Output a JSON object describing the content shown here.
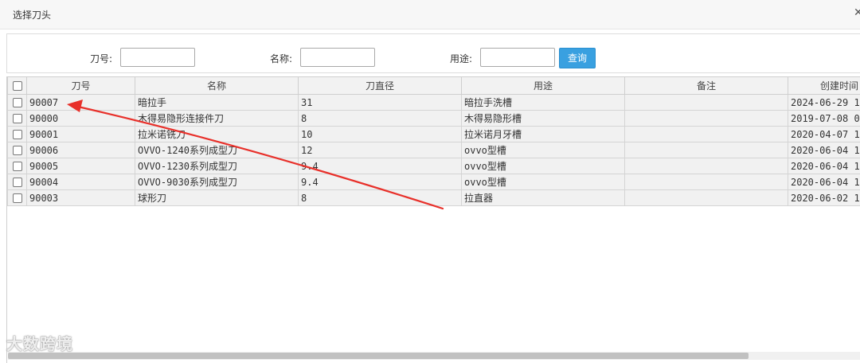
{
  "dialog": {
    "title": "选择刀头",
    "close_glyph": "✕"
  },
  "search": {
    "fields": [
      {
        "label": "刀号:",
        "value": ""
      },
      {
        "label": "名称:",
        "value": ""
      },
      {
        "label": "用途:",
        "value": ""
      }
    ],
    "query_button": "查询"
  },
  "table": {
    "columns": [
      "刀号",
      "名称",
      "刀直径",
      "用途",
      "备注",
      "创建时间"
    ],
    "rows": [
      {
        "code": "90007",
        "name": "暗拉手",
        "diameter": "31",
        "usage": "暗拉手洗槽",
        "note": "",
        "created": "2024-06-29 1"
      },
      {
        "code": "90000",
        "name": "木得易隐形连接件刀",
        "diameter": "8",
        "usage": "木得易隐形槽",
        "note": "",
        "created": "2019-07-08 0"
      },
      {
        "code": "90001",
        "name": "拉米诺铣刀",
        "diameter": "10",
        "usage": "拉米诺月牙槽",
        "note": "",
        "created": "2020-04-07 1"
      },
      {
        "code": "90006",
        "name": "OVVO-1240系列成型刀",
        "diameter": "12",
        "usage": "ovvo型槽",
        "note": "",
        "created": "2020-06-04 1"
      },
      {
        "code": "90005",
        "name": "OVVO-1230系列成型刀",
        "diameter": "9.4",
        "usage": "ovvo型槽",
        "note": "",
        "created": "2020-06-04 1"
      },
      {
        "code": "90004",
        "name": "OVVO-9030系列成型刀",
        "diameter": "9.4",
        "usage": "ovvo型槽",
        "note": "",
        "created": "2020-06-04 1"
      },
      {
        "code": "90003",
        "name": "球形刀",
        "diameter": "8",
        "usage": "拉直器",
        "note": "",
        "created": "2020-06-02 1"
      }
    ]
  },
  "annotation": {
    "arrow_color": "#e8302a"
  },
  "watermark": {
    "text": "大数跨境"
  }
}
